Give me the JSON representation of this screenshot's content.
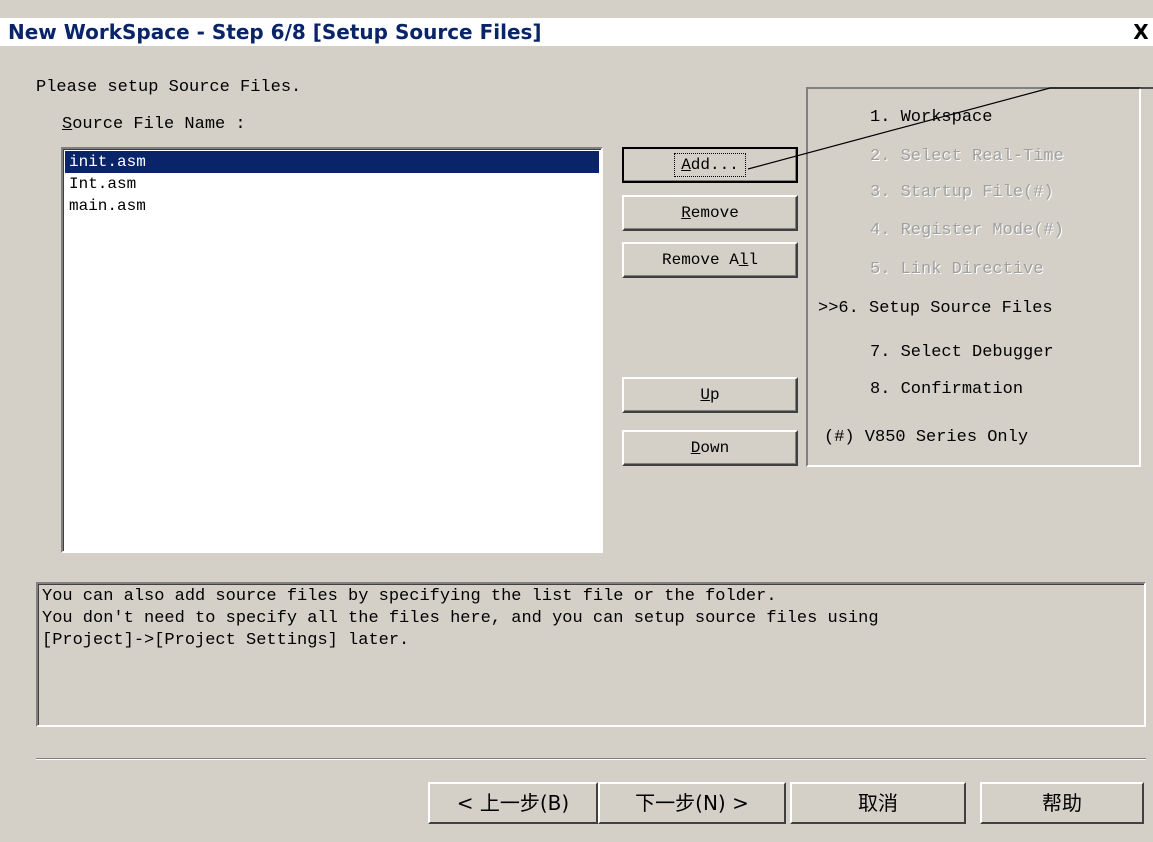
{
  "window": {
    "title": "New WorkSpace - Step 6/8 [Setup Source Files]",
    "close_glyph": "X"
  },
  "prompt": "Please setup Source Files.",
  "source_label": {
    "mnemonic": "S",
    "rest": "ource File Name :"
  },
  "files": [
    "init.asm",
    "Int.asm",
    "main.asm"
  ],
  "buttons": {
    "add": {
      "mnemonic": "A",
      "rest": "dd..."
    },
    "remove": {
      "mnemonic": "R",
      "rest": "emove"
    },
    "remove_all": {
      "pre": "Remove A",
      "mnemonic": "l",
      "rest": "l"
    },
    "up": {
      "mnemonic": "U",
      "rest": "p"
    },
    "down": {
      "mnemonic": "D",
      "rest": "own"
    }
  },
  "steps": [
    "1. Workspace",
    "2. Select Real-Time",
    "3. Startup File(#)",
    "4. Register Mode(#)",
    "5. Link Directive",
    ">>6. Setup Source Files",
    "7. Select Debugger",
    "8. Confirmation",
    "(#) V850 Series Only"
  ],
  "info_text": "You can also add source files by specifying the list file or the folder.\nYou don't need to specify all the files here, and you can setup source files using\n[Project]->[Project Settings] later.",
  "nav": {
    "back": "< 上一步(B)",
    "next": "下一步(N) >",
    "cancel": "取消",
    "help": "帮助"
  },
  "colors": {
    "selection": "#0a246a",
    "face": "#d4d0c8",
    "disabled_text": "#a0a0a0"
  }
}
